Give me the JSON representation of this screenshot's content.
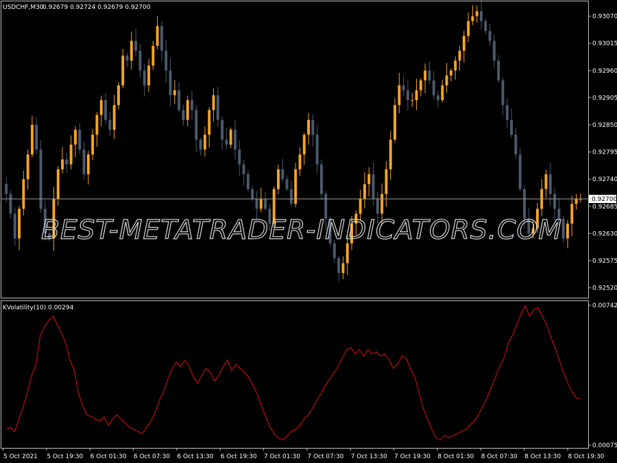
{
  "window": {
    "title": "USDCHF,M30",
    "ohlc_readout": "0.92679 0.92724 0.92679 0.92700"
  },
  "watermark": "BEST-METATRADER-INDICATORS.COM",
  "colors": {
    "background": "#000000",
    "frame": "#c0c0c0",
    "bull": "#f6a523",
    "bear": "#4a5a6e",
    "indicator": "#e01010",
    "price_line": "#a0a0a0",
    "text": "#ffffff"
  },
  "chart_data": [
    {
      "type": "candlestick",
      "title": "USDCHF,M30",
      "subtitle": "0.92679 0.92724 0.92679 0.92700",
      "ylim": [
        0.925,
        0.931
      ],
      "y_ticks": [
        "0.93070",
        "0.93015",
        "0.92960",
        "0.92905",
        "0.92850",
        "0.92795",
        "0.92740",
        "0.92685",
        "0.92630",
        "0.92575",
        "0.92520"
      ],
      "current_price": "0.92700",
      "candle_count": 140,
      "close": [
        0.9271,
        0.9267,
        0.9262,
        0.9268,
        0.9274,
        0.9279,
        0.9285,
        0.928,
        0.9268,
        0.9263,
        0.9262,
        0.927,
        0.9276,
        0.9278,
        0.9277,
        0.9281,
        0.9284,
        0.928,
        0.9275,
        0.9279,
        0.9283,
        0.9287,
        0.929,
        0.9286,
        0.9284,
        0.9289,
        0.9293,
        0.9299,
        0.9298,
        0.9302,
        0.93,
        0.9296,
        0.9293,
        0.9297,
        0.9301,
        0.9305,
        0.93,
        0.9296,
        0.9291,
        0.9292,
        0.9288,
        0.9286,
        0.929,
        0.9288,
        0.9282,
        0.928,
        0.9283,
        0.9288,
        0.9291,
        0.9286,
        0.9282,
        0.9281,
        0.9284,
        0.928,
        0.9277,
        0.9275,
        0.9272,
        0.927,
        0.9268,
        0.927,
        0.9268,
        0.9265,
        0.9272,
        0.9276,
        0.9274,
        0.9272,
        0.9269,
        0.9276,
        0.9279,
        0.9283,
        0.9286,
        0.9283,
        0.9277,
        0.9271,
        0.9266,
        0.9261,
        0.9258,
        0.9255,
        0.9257,
        0.9261,
        0.9265,
        0.9267,
        0.927,
        0.9273,
        0.9275,
        0.927,
        0.9267,
        0.9271,
        0.9276,
        0.9282,
        0.9289,
        0.9293,
        0.9292,
        0.929,
        0.929,
        0.9292,
        0.9294,
        0.9296,
        0.9294,
        0.9291,
        0.929,
        0.9293,
        0.9295,
        0.9296,
        0.9298,
        0.93,
        0.9303,
        0.9306,
        0.9307,
        0.9308,
        0.9306,
        0.9304,
        0.9302,
        0.9298,
        0.9294,
        0.9289,
        0.9286,
        0.9283,
        0.9279,
        0.9272,
        0.9266,
        0.9263,
        0.9264,
        0.9268,
        0.9272,
        0.9275,
        0.9271,
        0.9268,
        0.9266,
        0.9262,
        0.9265,
        0.9269,
        0.927,
        0.927
      ],
      "x_ticks": [
        "5 Oct 2021",
        "5 Oct 19:30",
        "6 Oct 01:30",
        "6 Oct 07:30",
        "6 Oct 13:30",
        "6 Oct 19:30",
        "7 Oct 01:30",
        "7 Oct 07:30",
        "7 Oct 13:30",
        "7 Oct 19:30",
        "8 Oct 01:30",
        "8 Oct 07:30",
        "8 Oct 13:30",
        "8 Oct 19:30"
      ]
    },
    {
      "type": "line",
      "title": "KVolatility(10) 0.00294",
      "ylim": [
        0.00075,
        0.00742
      ],
      "y_ticks": [
        "0.00742",
        "0.00075"
      ],
      "series": [
        {
          "name": "KVolatility(10)",
          "values": [
            0.0015,
            0.0016,
            0.0014,
            0.002,
            0.0026,
            0.0033,
            0.0041,
            0.0046,
            0.006,
            0.0064,
            0.0067,
            0.0069,
            0.0065,
            0.0061,
            0.0056,
            0.0048,
            0.0043,
            0.0032,
            0.0026,
            0.0022,
            0.0021,
            0.002,
            0.0019,
            0.0021,
            0.0017,
            0.002,
            0.0022,
            0.002,
            0.0018,
            0.0016,
            0.0015,
            0.0014,
            0.0013,
            0.0016,
            0.0019,
            0.0023,
            0.0029,
            0.0033,
            0.0039,
            0.0044,
            0.0047,
            0.0045,
            0.0048,
            0.0045,
            0.004,
            0.0037,
            0.0041,
            0.0044,
            0.0042,
            0.0038,
            0.0041,
            0.0045,
            0.0048,
            0.0043,
            0.0046,
            0.0044,
            0.0042,
            0.004,
            0.0036,
            0.0032,
            0.0026,
            0.0021,
            0.0016,
            0.0013,
            0.0011,
            0.001,
            0.0012,
            0.0014,
            0.0015,
            0.0017,
            0.002,
            0.0022,
            0.0025,
            0.0029,
            0.0032,
            0.0036,
            0.0039,
            0.0042,
            0.0045,
            0.0049,
            0.0053,
            0.0054,
            0.0051,
            0.0053,
            0.005,
            0.0053,
            0.0051,
            0.0052,
            0.005,
            0.0051,
            0.0048,
            0.0044,
            0.0046,
            0.005,
            0.0049,
            0.0044,
            0.004,
            0.0033,
            0.0025,
            0.002,
            0.0015,
            0.0011,
            0.001,
            0.0012,
            0.0011,
            0.0012,
            0.0013,
            0.0014,
            0.0015,
            0.0017,
            0.0019,
            0.0022,
            0.0026,
            0.003,
            0.0035,
            0.004,
            0.0045,
            0.0049,
            0.0056,
            0.006,
            0.0065,
            0.007,
            0.0074,
            0.0069,
            0.0072,
            0.0073,
            0.0069,
            0.0065,
            0.0059,
            0.0054,
            0.0048,
            0.0042,
            0.0037,
            0.0033,
            0.003,
            0.00294
          ]
        }
      ]
    }
  ]
}
